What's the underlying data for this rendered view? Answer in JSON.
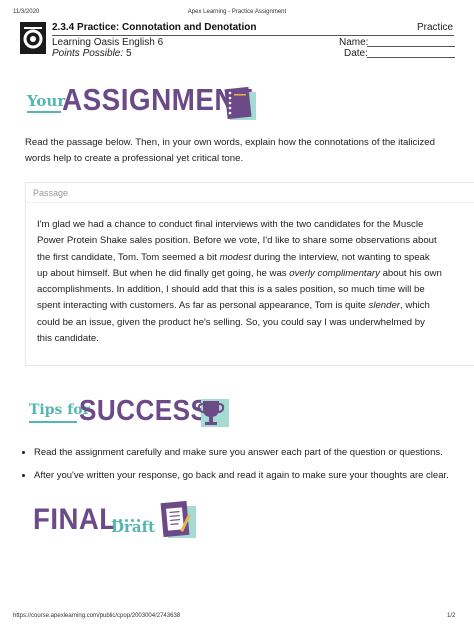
{
  "print_header": {
    "date": "11/3/2020",
    "center_title": "Apex Learning - Practice Assignment"
  },
  "header": {
    "title": "2.3.4 Practice: Connotation and Denotation",
    "course": "Learning Oasis English 6",
    "points_label": "Points Possible:",
    "points_value": "5",
    "right_label": "Practice",
    "name_label": "Name:",
    "date_label": "Date:"
  },
  "assignment_banner": {
    "small": "Your",
    "big": "ASSIGNMENT"
  },
  "instructions": "Read the passage below. Then, in your own words, explain how the connotations of the italicized words help to create a professional yet critical tone.",
  "passage": {
    "label": "Passage",
    "p1": "I'm glad we had a chance to conduct final interviews with the two candidates for the Muscle Power Protein Shake sales position. Before we vote, I'd like to share some observations about the first candidate, Tom. Tom seemed a bit ",
    "em1": "modest",
    "p2": " during the interview, not wanting to speak up about himself. But when he did finally get going, he was ",
    "em2": "overly complimentary",
    "p3": " about his own accomplishments. In addition, I should add that this is a sales position, so much time will be spent interacting with customers. As far as personal appearance, Tom is quite ",
    "em3": "slender",
    "p4": ", which could be an issue, given the product he's selling. So, you could say I was underwhelmed by this candidate."
  },
  "tips_banner": {
    "small": "Tips for",
    "big": "SUCCESS"
  },
  "tips": [
    "Read the assignment carefully and make sure you answer each part of the question or questions.",
    "After you've written your response, go back and read it again to make sure your thoughts are clear."
  ],
  "final_banner": {
    "big": "FINAL",
    "small": "Draft"
  },
  "footer": {
    "url": "https://course.apexlearning.com/public/cpop/2003004/2743638",
    "page": "1/2"
  },
  "colors": {
    "purple": "#6b4a87",
    "teal": "#54b6b0",
    "gold": "#e8b64c"
  }
}
